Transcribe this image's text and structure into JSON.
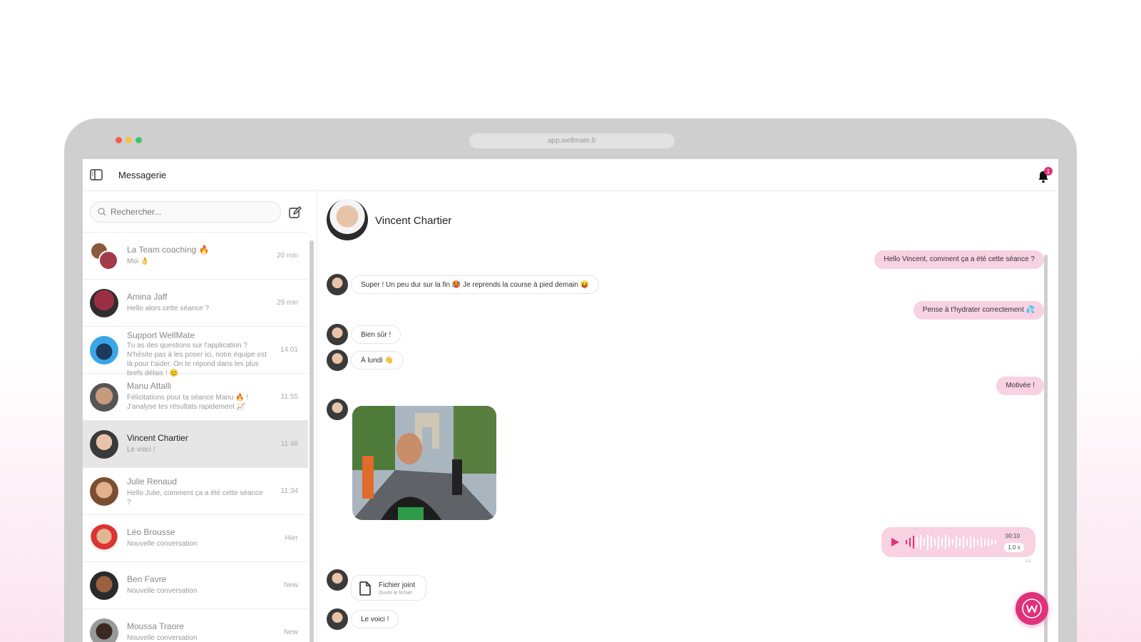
{
  "browser": {
    "url": "app.wellmate.fr",
    "dots": [
      "#f25c54",
      "#f6c343",
      "#3ec46d"
    ]
  },
  "topbar": {
    "title": "Messagerie",
    "notifications": "1"
  },
  "search": {
    "placeholder": "Rechercher..."
  },
  "conversations": [
    {
      "name": "La Team coaching 🔥",
      "preview": "Moi 👌",
      "time": "20 min"
    },
    {
      "name": "Amina Jaff",
      "preview": "Hello alors cette séance ?",
      "time": "29 min"
    },
    {
      "name": "Support WellMate",
      "preview": "Tu as des questions sur l'application ? N'hésite pas à les poser ici, notre équipe est là pour t'aider. On te répond dans les plus brefs délais ! 😊",
      "time": "14:01"
    },
    {
      "name": "Manu Attalli",
      "preview": "Félicitations pour ta séance Manu 🔥 ! J'analyse tes résultats rapidement 📈",
      "time": "11:55"
    },
    {
      "name": "Vincent Chartier",
      "preview": "Le voici !",
      "time": "11:46"
    },
    {
      "name": "Julie Renaud",
      "preview": "Hello Julie, comment ça a été cette séance ?",
      "time": "11:34"
    },
    {
      "name": "Léo Brousse",
      "preview": "Nouvelle conversation",
      "time": "Hier"
    },
    {
      "name": "Ben Favre",
      "preview": "Nouvelle conversation",
      "time": "New"
    },
    {
      "name": "Moussa Traore",
      "preview": "Nouvelle conversation",
      "time": "New"
    }
  ],
  "chat": {
    "contact": "Vincent Chartier",
    "messages": {
      "m1": "Hello Vincent, comment ça a été cette séance ?",
      "m2": "Super ! Un peu dur sur la fin 🥵 Je reprends la course à pied demain 😝",
      "m3": "Pense à t'hydrater correctement 💦",
      "m4": "Bien sûr !",
      "m5": "À lundi 👋",
      "m6": "Motivée !",
      "m7": "Le voici !"
    },
    "voice": {
      "duration": "00:10",
      "speed": "1.0 x",
      "status": "Lu"
    },
    "file": {
      "name": "Fichier joint",
      "action": "Ouvrir le fichier"
    }
  },
  "colors": {
    "accent": "#e0317a",
    "bubble_out": "#f8d2e1"
  },
  "icons": [
    "sidebar-toggle-icon",
    "bell-icon",
    "search-icon",
    "compose-icon",
    "play-icon",
    "file-icon",
    "brand-logo-icon"
  ]
}
